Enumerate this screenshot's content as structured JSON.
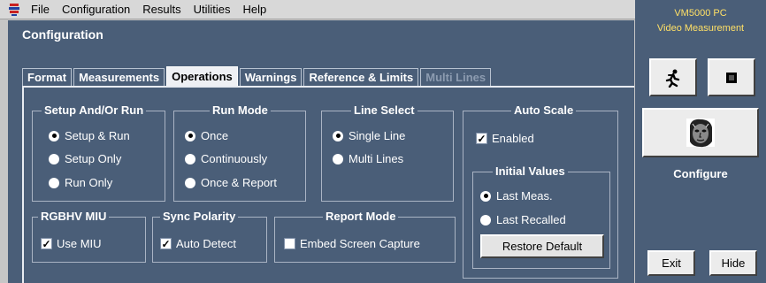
{
  "menubar": {
    "app_icon": "tektronix-logo-icon",
    "items": [
      "File",
      "Configuration",
      "Results",
      "Utilities",
      "Help"
    ]
  },
  "brand": {
    "line1": "VM5000 PC",
    "line2": "Video Measurement"
  },
  "panel": {
    "title": "Configuration"
  },
  "tabs": [
    {
      "label": "Format",
      "state": "inactive"
    },
    {
      "label": "Measurements",
      "state": "inactive"
    },
    {
      "label": "Operations",
      "state": "active"
    },
    {
      "label": "Warnings",
      "state": "inactive"
    },
    {
      "label": "Reference & Limits",
      "state": "inactive"
    },
    {
      "label": "Multi Lines",
      "state": "disabled"
    }
  ],
  "setup_run": {
    "title": "Setup And/Or Run",
    "options": [
      "Setup & Run",
      "Setup Only",
      "Run Only"
    ],
    "selected": "Setup & Run"
  },
  "run_mode": {
    "title": "Run Mode",
    "options": [
      "Once",
      "Continuously",
      "Once & Report"
    ],
    "selected": "Once"
  },
  "line_select": {
    "title": "Line Select",
    "options": [
      "Single Line",
      "Multi Lines"
    ],
    "selected": "Single Line"
  },
  "auto_scale": {
    "title": "Auto Scale",
    "enabled_label": "Enabled",
    "enabled": true,
    "initial_values": {
      "title": "Initial Values",
      "options": [
        "Last Meas.",
        "Last Recalled"
      ],
      "selected": "Last Meas."
    },
    "restore_label": "Restore Default"
  },
  "rgbhv": {
    "title": "RGBHV MIU",
    "label": "Use MIU",
    "checked": true
  },
  "sync_polarity": {
    "title": "Sync Polarity",
    "label": "Auto Detect",
    "checked": true
  },
  "report_mode": {
    "title": "Report Mode",
    "label": "Embed Screen Capture",
    "checked": false
  },
  "side": {
    "run_icon": "running-man-icon",
    "stop_icon": "stop-icon",
    "configure_icon": "face-portrait-icon",
    "configure_label": "Configure",
    "exit_label": "Exit",
    "hide_label": "Hide"
  },
  "colors": {
    "panel_bg": "#4a5e78",
    "brand_text": "#ffe066",
    "menubar_bg": "#d8d8d8"
  }
}
